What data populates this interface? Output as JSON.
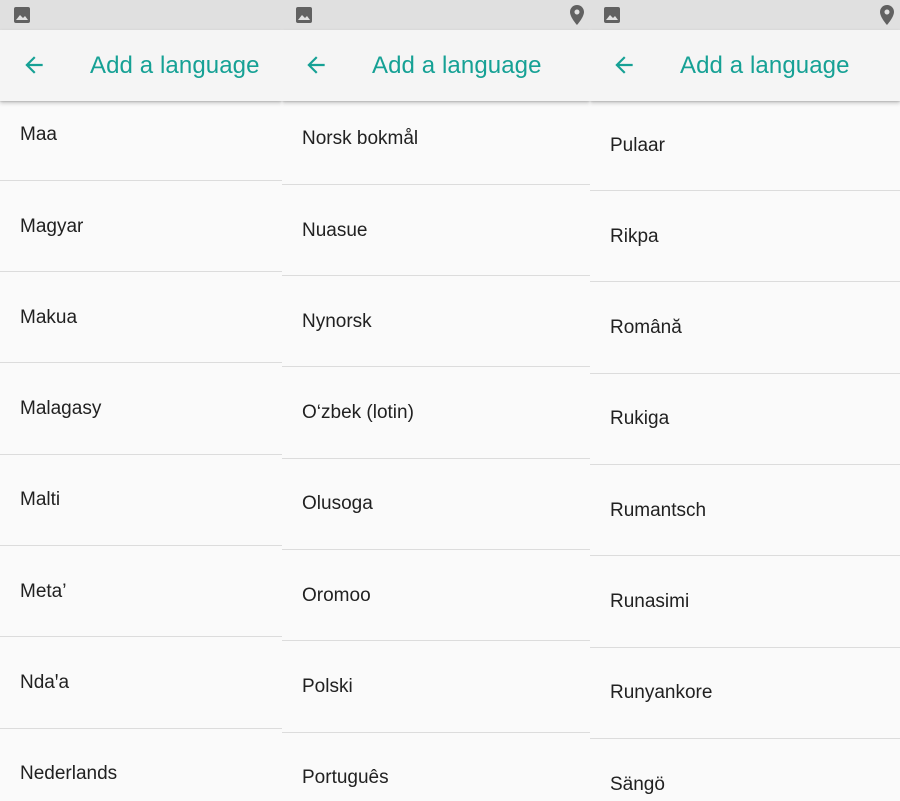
{
  "screens": [
    {
      "title": "Add a language",
      "languages": [
        "Maa",
        "Magyar",
        "Makua",
        "Malagasy",
        "Malti",
        "Meta’",
        "Ndaꞌa",
        "Nederlands"
      ]
    },
    {
      "title": "Add a language",
      "languages": [
        "Norsk bokmål",
        "Nuasue",
        "Nynorsk",
        "O‘zbek (lotin)",
        "Olusoga",
        "Oromoo",
        "Polski",
        "Português"
      ]
    },
    {
      "title": "Add a language",
      "languages": [
        "Pulaar",
        "Rikpa",
        "Română",
        "Rukiga",
        "Rumantsch",
        "Runasimi",
        "Runyankore",
        "Sängö"
      ]
    }
  ],
  "icons": {
    "status_left": "image-icon",
    "status_right": "location-pin-icon",
    "back": "arrow-back-icon"
  },
  "colors": {
    "accent": "#16a195",
    "status_bar": "#e0e0e0",
    "app_bar": "#f5f5f5",
    "background": "#fafafa",
    "text": "#212121",
    "divider": "#dcdcdc"
  }
}
